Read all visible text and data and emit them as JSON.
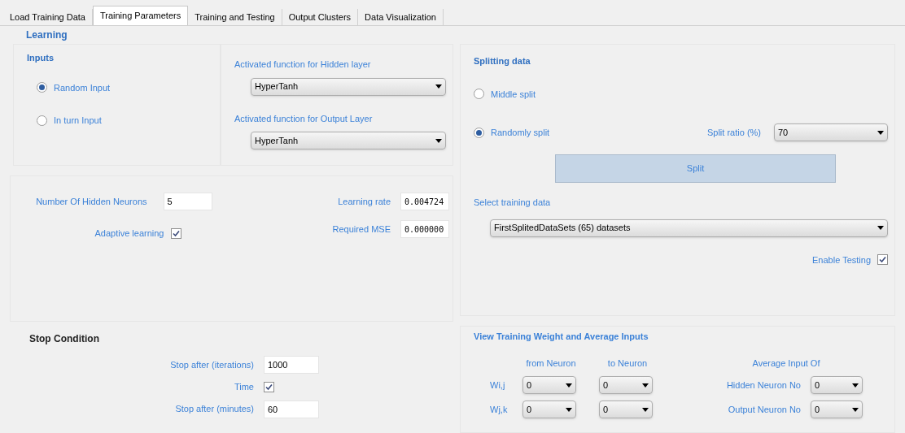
{
  "tabs": [
    {
      "label": "Load Training Data",
      "selected": false
    },
    {
      "label": "Training Parameters",
      "selected": true
    },
    {
      "label": "Training and Testing",
      "selected": false
    },
    {
      "label": "Output Clusters",
      "selected": false
    },
    {
      "label": "Data Visualization",
      "selected": false
    }
  ],
  "learning": {
    "title": "Learning",
    "inputs": {
      "title": "Inputs",
      "options": [
        {
          "label": "Random Input",
          "selected": true
        },
        {
          "label": "In turn Input",
          "selected": false
        }
      ]
    },
    "hidden_activation": {
      "label": "Activated function for Hidden layer",
      "value": "HyperTanh"
    },
    "output_activation": {
      "label": "Activated function for Output Layer",
      "value": "HyperTanh"
    },
    "hidden_neurons": {
      "label": "Number Of Hidden Neurons",
      "value": "5"
    },
    "adaptive_learning": {
      "label": "Adaptive learning",
      "checked": true
    },
    "learning_rate": {
      "label": "Learning rate",
      "value": "0.004724"
    },
    "required_mse": {
      "label": "Required MSE",
      "value": "0.000000"
    }
  },
  "stop_condition": {
    "title": "Stop Condition",
    "iterations": {
      "label": "Stop after (iterations)",
      "value": "1000"
    },
    "time": {
      "label": "Time",
      "checked": true
    },
    "minutes": {
      "label": "Stop after (minutes)",
      "value": "60"
    }
  },
  "splitting": {
    "title": "Splitting data",
    "options": [
      {
        "label": "Middle split",
        "selected": false
      },
      {
        "label": "Randomly split",
        "selected": true
      }
    ],
    "split_ratio": {
      "label": "Split ratio (%)",
      "value": "70"
    },
    "split_button": "Split",
    "training_data": {
      "label": "Select training data",
      "value": "FirstSplitedDataSets (65) datasets"
    },
    "enable_testing": {
      "label": "Enable Testing",
      "checked": true
    }
  },
  "weights": {
    "title": "View Training Weight and Average Inputs",
    "from_label": "from Neuron",
    "to_label": "to Neuron",
    "rows": [
      {
        "label": "Wi,j",
        "from": "0",
        "to": "0"
      },
      {
        "label": "Wj,k",
        "from": "0",
        "to": "0"
      }
    ],
    "average": {
      "title": "Average Input Of",
      "rows": [
        {
          "label": "Hidden Neuron No",
          "value": "0"
        },
        {
          "label": "Output Neuron No",
          "value": "0"
        }
      ]
    }
  }
}
